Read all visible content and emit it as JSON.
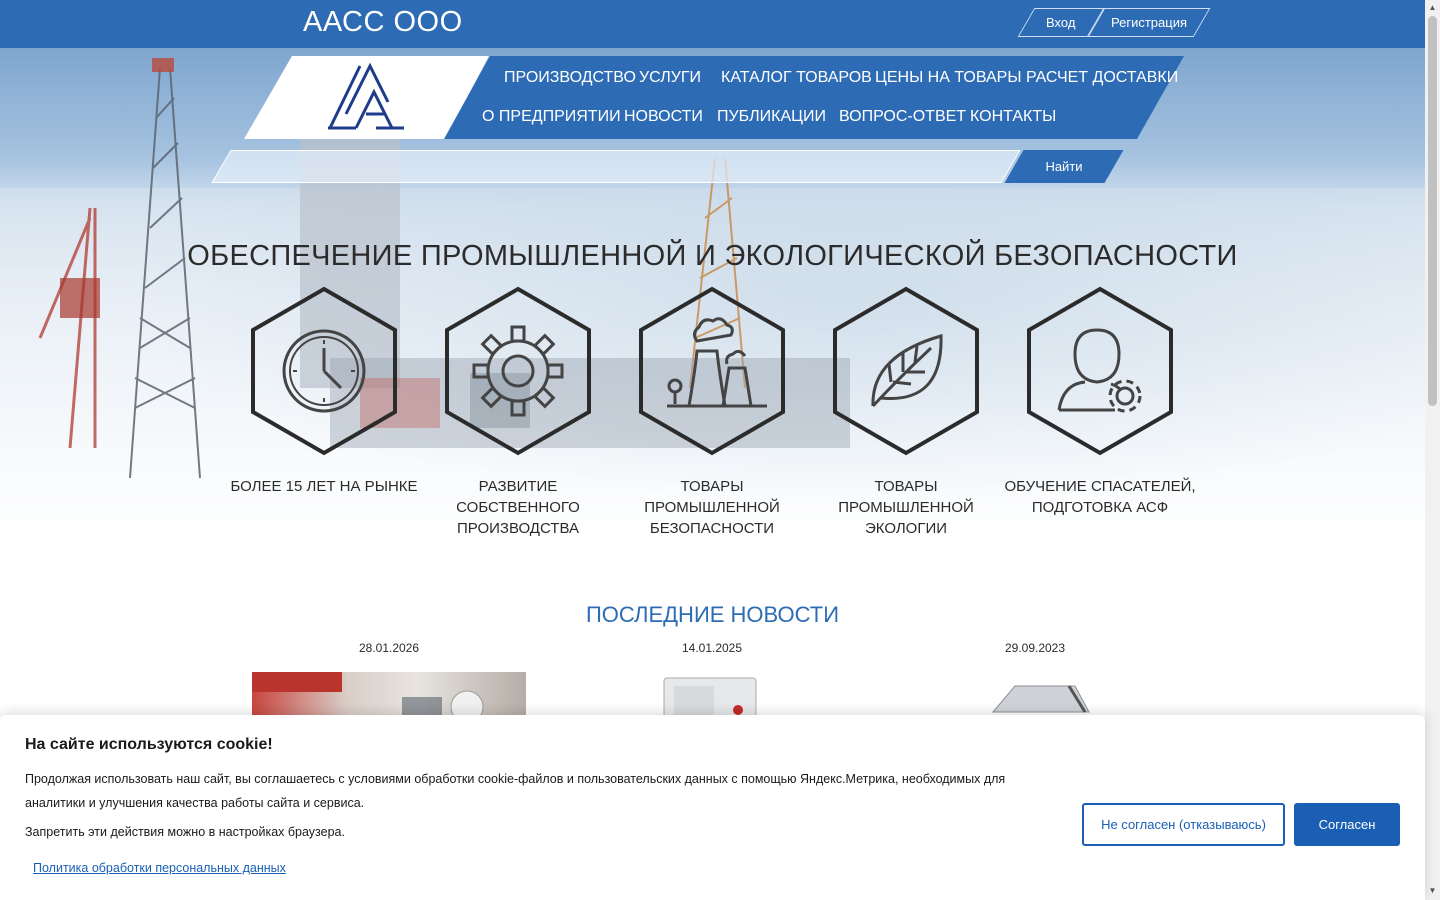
{
  "header": {
    "brand": "ААСС ООО",
    "login_label": "Вход",
    "register_label": "Регистрация"
  },
  "nav": {
    "row1": [
      "ПРОИЗВОДСТВО",
      "УСЛУГИ",
      "КАТАЛОГ ТОВАРОВ",
      "ЦЕНЫ НА ТОВАРЫ",
      "РАСЧЕТ ДОСТАВКИ"
    ],
    "row2": [
      "О ПРЕДПРИЯТИИ",
      "НОВОСТИ",
      "ПУБЛИКАЦИИ",
      "ВОПРОС-ОТВЕТ",
      "КОНТАКТЫ"
    ]
  },
  "search": {
    "placeholder": "",
    "button_label": "Найти"
  },
  "hero": {
    "title": "ОБЕСПЕЧЕНИЕ ПРОМЫШЛЕННОЙ И ЭКОЛОГИЧЕСКОЙ БЕЗОПАСНОСТИ",
    "features": [
      {
        "icon": "clock-icon",
        "label": "БОЛЕЕ 15 ЛЕТ НА РЫНКЕ"
      },
      {
        "icon": "gear-icon",
        "label": "РАЗВИТИЕ СОБСТВЕННОГО ПРОИЗВОДСТВА"
      },
      {
        "icon": "factory-icon",
        "label": "ТОВАРЫ ПРОМЫШЛЕННОЙ БЕЗОПАСНОСТИ"
      },
      {
        "icon": "leaf-icon",
        "label": "ТОВАРЫ ПРОМЫШЛЕННОЙ ЭКОЛОГИИ"
      },
      {
        "icon": "user-gear-icon",
        "label": "ОБУЧЕНИЕ СПАСАТЕЛЕЙ, ПОДГОТОВКА АСФ"
      }
    ]
  },
  "news": {
    "title": "ПОСЛЕДНИЕ НОВОСТИ",
    "items": [
      {
        "date": "28.01.2026"
      },
      {
        "date": "14.01.2025"
      },
      {
        "date": "29.09.2023"
      }
    ]
  },
  "cookie": {
    "title": "На сайте используются cookie!",
    "text": "Продолжая использовать наш сайт, вы соглашаетесь с условиями обработки cookie-файлов и пользовательских данных с помощью Яндекс.Метрика, необходимых для аналитики и улучшения качества работы сайта и сервиса.",
    "text2": "Запретить эти действия можно в настройках браузера.",
    "policy_link": "Политика обработки персональных данных",
    "decline_label": "Не согласен (отказываюсь)",
    "accept_label": "Согласен"
  },
  "colors": {
    "brand_blue": "#2d6cb5",
    "cookie_blue": "#1a5fb4"
  }
}
